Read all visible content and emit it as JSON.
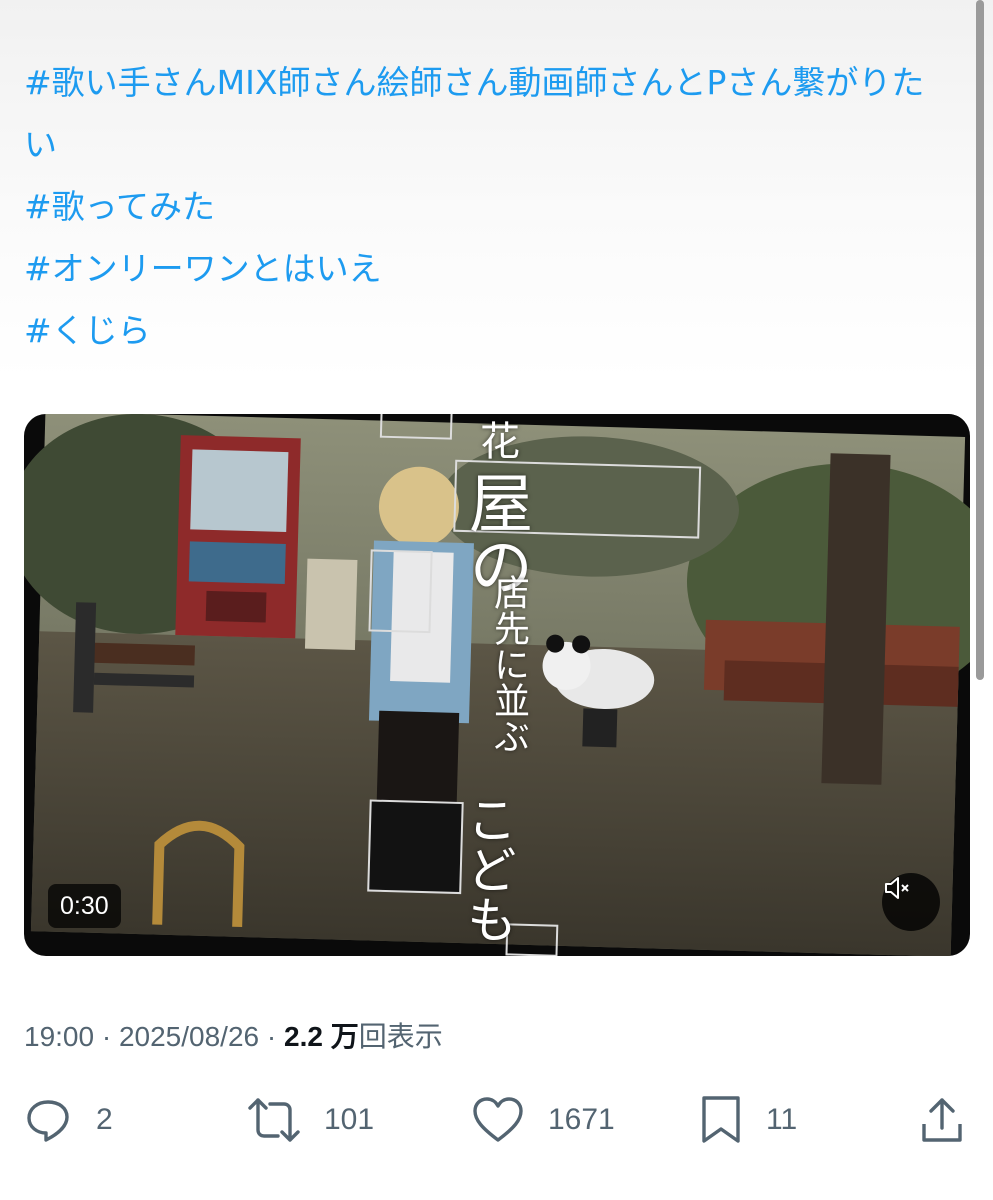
{
  "hashtags": [
    "#歌い手さんMIX師さん絵師さん動画師さんとPさん繋がりたい",
    "#歌ってみた",
    "#オンリーワンとはいえ",
    " #くじら"
  ],
  "video": {
    "duration": "0:30",
    "lyrics_col1": "花",
    "lyrics_col2": "屋の",
    "lyrics_col3": "店先に並ぶ",
    "lyrics_col4": "こども"
  },
  "meta": {
    "time": "19:00",
    "separator1": "·",
    "date": "2025/08/26",
    "separator2": "·",
    "views": "2.2 万",
    "views_suffix": "回表示"
  },
  "actions": {
    "replies": "2",
    "reposts": "101",
    "likes": "1671",
    "bookmarks": "11"
  },
  "icons": {
    "reply": "reply-icon",
    "repost": "repost-icon",
    "like": "heart-icon",
    "bookmark": "bookmark-icon",
    "share": "share-icon",
    "mute": "mute-icon"
  },
  "colors": {
    "link": "#1d9bf0",
    "secondary": "#536471",
    "primary": "#0f1419"
  }
}
